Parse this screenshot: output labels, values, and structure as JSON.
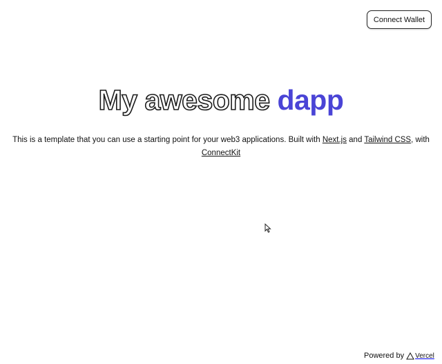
{
  "header": {
    "connect_button_label": "Connect Wallet"
  },
  "hero": {
    "title_main": "My awesome ",
    "title_accent": "dapp",
    "description_prefix": "This is a template that you can use a starting point for your web3 applications. Built with ",
    "link_nextjs": "Next.js",
    "description_and": " and ",
    "link_tailwind": "Tailwind CSS",
    "description_with": ", with ",
    "link_connectkit": "ConnectKit"
  },
  "footer": {
    "powered_by": "Powered by",
    "vercel_label": "Vercel",
    "vercel_icon": "vercel-triangle-icon"
  },
  "colors": {
    "accent": "#4a44d6",
    "text": "#111111",
    "background": "#ffffff"
  }
}
